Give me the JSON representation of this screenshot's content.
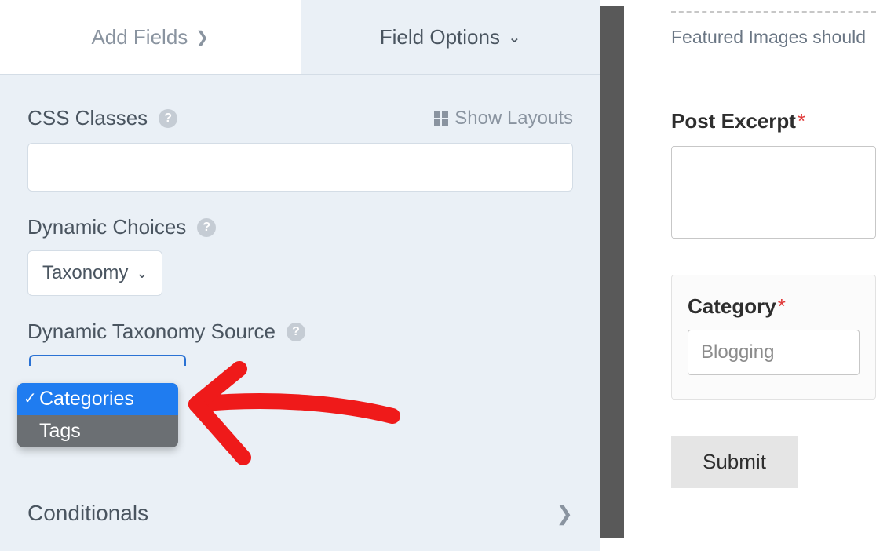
{
  "tabs": {
    "add_fields": "Add Fields",
    "field_options": "Field Options"
  },
  "css_classes": {
    "label": "CSS Classes",
    "show_layouts": "Show Layouts",
    "value": ""
  },
  "dynamic_choices": {
    "label": "Dynamic Choices",
    "selected": "Taxonomy"
  },
  "dynamic_taxonomy_source": {
    "label": "Dynamic Taxonomy Source",
    "options": [
      "Categories",
      "Tags"
    ],
    "selected": "Categories"
  },
  "conditionals": {
    "label": "Conditionals"
  },
  "preview": {
    "hint": "Featured Images should",
    "post_excerpt_label": "Post Excerpt",
    "category_label": "Category",
    "category_value": "Blogging",
    "submit_label": "Submit"
  }
}
